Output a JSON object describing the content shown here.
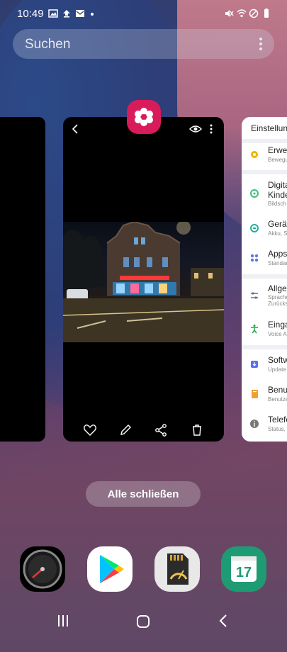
{
  "status": {
    "time": "10:49"
  },
  "search": {
    "placeholder": "Suchen"
  },
  "recents": {
    "main_app_icon": "gallery-flower-icon",
    "right_app": {
      "title": "Einstellungen",
      "items": [
        {
          "title": "Erweit",
          "subtitle": "Bewegu",
          "color": "#f0b400"
        },
        {
          "title": "Digita",
          "title2": "Kinder",
          "subtitle": "Bildsch",
          "color": "#3cc07a"
        },
        {
          "title": "Gerät",
          "subtitle": "Akku, S",
          "color": "#1bb39a"
        },
        {
          "title": "Apps",
          "subtitle": "Standar",
          "color": "#5a7be0"
        },
        {
          "title": "Allger",
          "subtitle": "Sprache",
          "subtitle2": "Zurücks",
          "color": "#5b7398"
        },
        {
          "title": "Einga",
          "subtitle": "Voice A",
          "color": "#2aa34a"
        },
        {
          "title": "Softw",
          "subtitle": "Update",
          "color": "#5a6ff0"
        },
        {
          "title": "Benut",
          "subtitle": "Benutze",
          "color": "#f0a030"
        },
        {
          "title": "Telefo",
          "subtitle": "Status,",
          "color": "#777777"
        }
      ]
    }
  },
  "actions": {
    "close_all": "Alle schließen"
  },
  "dock": [
    "speedometer-app-icon",
    "play-store-icon",
    "sd-card-speed-icon",
    "calendar-icon"
  ],
  "calendar_day": "17"
}
